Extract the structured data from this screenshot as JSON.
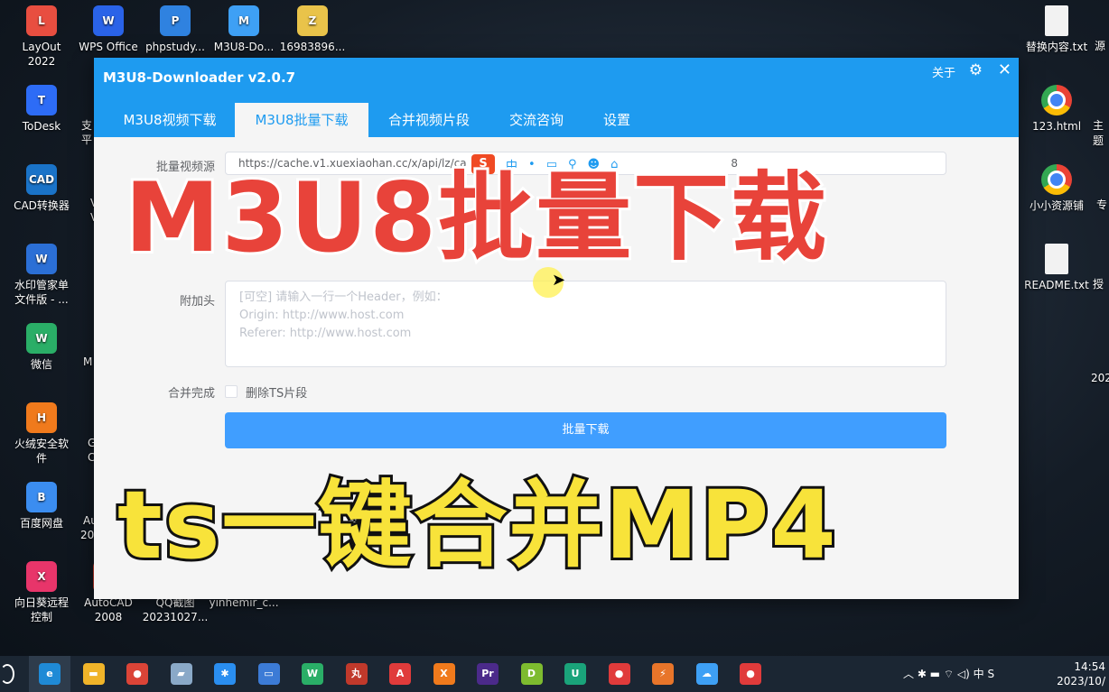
{
  "desktop": {
    "icons_left": [
      {
        "label": "LayOut\n2022",
        "color": "#e84e40",
        "glyph": "L"
      },
      {
        "label": "ToDesk",
        "color": "#2d6cf6",
        "glyph": "T"
      },
      {
        "label": "CAD转换器",
        "color": "#1a73c8",
        "glyph": "CAD"
      },
      {
        "label": "水印管家单\n文件版 - ...",
        "color": "#2b6fd6",
        "glyph": "W"
      },
      {
        "label": "微信",
        "color": "#2aae67",
        "glyph": "W"
      },
      {
        "label": "火绒安全软\n件",
        "color": "#f07a1c",
        "glyph": "H"
      },
      {
        "label": "百度网盘",
        "color": "#3b8df0",
        "glyph": "B"
      },
      {
        "label": "向日葵远程\n控制",
        "color": "#e8356a",
        "glyph": "X"
      }
    ],
    "icons_top": [
      {
        "label": "WPS Office",
        "color": "#2a63e8",
        "glyph": "W"
      },
      {
        "label": "phpstudy...",
        "color": "#2f82e0",
        "glyph": "P"
      },
      {
        "label": "M3U8-Do...",
        "color": "#3ea0f5",
        "glyph": "M"
      },
      {
        "label": "16983896...",
        "color": "#e9c34a",
        "glyph": "Z"
      }
    ],
    "icons_bottom": [
      {
        "label": "AutoCAD\n2008",
        "color": "#c0392b",
        "glyph": "A"
      },
      {
        "label": "QQ截图\n20231027...",
        "color": "#3a6ea5",
        "glyph": "Q"
      },
      {
        "label": "yinhemir_c...",
        "color": "#555555",
        "glyph": "Y"
      }
    ],
    "icons_right": [
      {
        "label": "替换内容.txt",
        "kind": "doc"
      },
      {
        "label": "123.html",
        "kind": "chrome"
      },
      {
        "label": "小小资源铺",
        "kind": "chrome"
      },
      {
        "label": "README.txt",
        "kind": "doc"
      }
    ],
    "partial_left": [
      "支",
      "平",
      "V",
      "V",
      "M",
      "G",
      "C",
      "Au",
      "202"
    ],
    "partial_right": [
      "源",
      "主题",
      "专",
      "授",
      "202"
    ]
  },
  "window": {
    "title": "M3U8-Downloader v2.0.7",
    "about": "关于",
    "gear_glyph": "⚙",
    "close_glyph": "✕",
    "tabs": [
      "M3U8视频下载",
      "M3U8批量下载",
      "合并视频片段",
      "交流咨询",
      "设置"
    ],
    "active_tab": 1,
    "form": {
      "url_label": "批量视频源",
      "url_value": "https://cache.v1.xuexiaohan.cc/x/api/lz/ca",
      "url_tail": "8",
      "header_label": "附加头",
      "header_placeholder": "[可空] 请输入一行一个Header，例如：\nOrigin: http://www.host.com\nReferer: http://www.host.com",
      "merge_label": "合并完成",
      "delete_ts_label": "删除TS片段",
      "delete_ts_checked": false,
      "batch_button": "批量下载"
    },
    "ime": {
      "logo": "S",
      "items": [
        "中",
        "•",
        "▭",
        "⚲",
        "☻",
        "⌂"
      ]
    }
  },
  "captions": {
    "top": "M3U8批量下载",
    "bottom": "ts一键合并MP4"
  },
  "taskbar": {
    "apps": [
      {
        "glyph": "e",
        "color": "#1f8ad6"
      },
      {
        "glyph": "▬",
        "color": "#f0b429"
      },
      {
        "glyph": "●",
        "color": "#db4437"
      },
      {
        "glyph": "▰",
        "color": "#8aa9c8"
      },
      {
        "glyph": "✱",
        "color": "#2a8ef0"
      },
      {
        "glyph": "▭",
        "color": "#3c7bd6"
      },
      {
        "glyph": "W",
        "color": "#2aae67"
      },
      {
        "glyph": "丸",
        "color": "#c0392b"
      },
      {
        "glyph": "A",
        "color": "#e03b3b"
      },
      {
        "glyph": "X",
        "color": "#f07a1c"
      },
      {
        "glyph": "Pr",
        "color": "#4b2a8a"
      },
      {
        "glyph": "D",
        "color": "#7dbb2f"
      },
      {
        "glyph": "U",
        "color": "#1aa37a"
      },
      {
        "glyph": "●",
        "color": "#e03b3b"
      },
      {
        "glyph": "⚡",
        "color": "#e8752a"
      },
      {
        "glyph": "☁",
        "color": "#3ea0f5"
      },
      {
        "glyph": "●",
        "color": "#e03b3b"
      }
    ],
    "tray_icons": "︿  ✱  ▬  ⌔  ◁)  中  S",
    "time": "14:54",
    "date": "2023/10/"
  }
}
